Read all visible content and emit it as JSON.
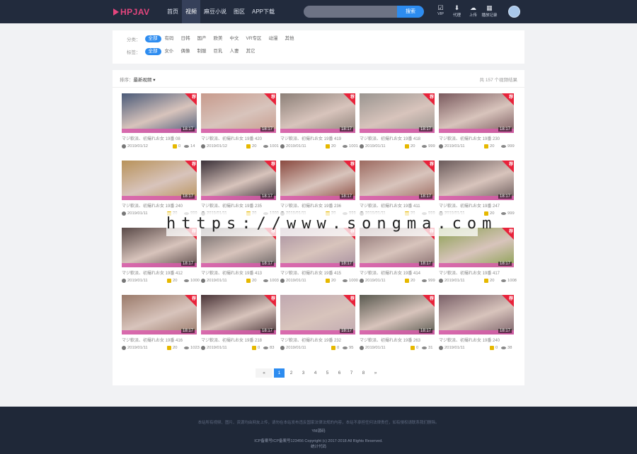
{
  "header": {
    "logo": "HPJAV",
    "nav": [
      "首页",
      "视频",
      "麻豆小说",
      "图区",
      "APP下载"
    ],
    "active_nav": 1,
    "search_placeholder": "",
    "search_button": "搜索",
    "icons": [
      {
        "icon": "vip-icon",
        "label": "VIP"
      },
      {
        "icon": "download-icon",
        "label": "代理"
      },
      {
        "icon": "upload-icon",
        "label": "上传"
      },
      {
        "icon": "history-icon",
        "label": "播放记录"
      }
    ]
  },
  "filters": {
    "row1": {
      "label": "分类：",
      "options": [
        "全部",
        "有码",
        "日韩",
        "国产",
        "欧美",
        "中文",
        "VR专区",
        "动漫",
        "其他"
      ],
      "selected": 0
    },
    "row2": {
      "label": "标签：",
      "options": [
        "全部",
        "女仆",
        "偶像",
        "制服",
        "巨乳",
        "人妻",
        "其它"
      ],
      "selected": 0
    }
  },
  "sortbar": {
    "label": "排序：",
    "value": "最新视频 ▾",
    "total": "共 157 个视频结果"
  },
  "cards": [
    {
      "title": "マジ軟派、初撮れお女 19番 08",
      "date": "2019/01/12",
      "coins": "0",
      "views": "14",
      "ribbon": "荐",
      "duration": "18:17",
      "color": "#4a5a78"
    },
    {
      "title": "マジ軟派、初撮れお女 19番 420",
      "date": "2019/01/12",
      "coins": "20",
      "views": "1001",
      "ribbon": "荐",
      "duration": "18:17",
      "color": "#c79a8c"
    },
    {
      "title": "マジ軟派、初撮れお女 19番 419",
      "date": "2019/01/11",
      "coins": "20",
      "views": "1001",
      "ribbon": "荐",
      "duration": "18:17",
      "color": "#8c8078"
    },
    {
      "title": "マジ軟派、初撮れお女 19番 418",
      "date": "2019/01/11",
      "coins": "20",
      "views": "999",
      "ribbon": "荐",
      "duration": "18:17",
      "color": "#9a9590"
    },
    {
      "title": "マジ軟派、初撮れお女 19番 230",
      "date": "2019/01/11",
      "coins": "20",
      "views": "999",
      "ribbon": "荐",
      "duration": "18:17",
      "color": "#7a5a5e"
    },
    {
      "title": "マジ軟派、初撮れお女 19番 240",
      "date": "2019/01/11",
      "coins": "20",
      "views": "999",
      "ribbon": "荐",
      "duration": "18:17",
      "color": "#b8925a"
    },
    {
      "title": "マジ軟派、初撮れお女 19番 235",
      "date": "2019/01/11",
      "coins": "20",
      "views": "1000",
      "ribbon": "荐",
      "duration": "18:17",
      "color": "#3a3038"
    },
    {
      "title": "マジ軟派、初撮れお女 19番 236",
      "date": "2019/01/11",
      "coins": "20",
      "views": "999",
      "ribbon": "荐",
      "duration": "18:17",
      "color": "#8a4a40"
    },
    {
      "title": "マジ軟派、初撮れお女 19番 411",
      "date": "2019/01/11",
      "coins": "20",
      "views": "999",
      "ribbon": "荐",
      "duration": "18:17",
      "color": "#9c6a60"
    },
    {
      "title": "マジ軟派、初撮れお女 19番 247",
      "date": "2019/01/11",
      "coins": "20",
      "views": "999",
      "ribbon": "荐",
      "duration": "18:17",
      "color": "#6a5a5a"
    },
    {
      "title": "マジ軟派、初撮れお女 19番 412",
      "date": "2019/01/11",
      "coins": "20",
      "views": "1000",
      "ribbon": "荐",
      "duration": "18:17",
      "color": "#5a4a48"
    },
    {
      "title": "マジ軟派、初撮れお女 19番 413",
      "date": "2019/01/11",
      "coins": "20",
      "views": "1003",
      "ribbon": "荐",
      "duration": "18:17",
      "color": "#6a6464"
    },
    {
      "title": "マジ軟派、初撮れお女 19番 415",
      "date": "2019/01/11",
      "coins": "20",
      "views": "1000",
      "ribbon": "荐",
      "duration": "18:17",
      "color": "#a890a0"
    },
    {
      "title": "マジ軟派、初撮れお女 19番 414",
      "date": "2019/01/11",
      "coins": "20",
      "views": "999",
      "ribbon": "荐",
      "duration": "18:17",
      "color": "#8a7070"
    },
    {
      "title": "マジ軟派、初撮れお女 19番 417",
      "date": "2019/01/11",
      "coins": "20",
      "views": "1008",
      "ribbon": "荐",
      "duration": "18:17",
      "color": "#8aa050"
    },
    {
      "title": "マジ軟派、初撮れお女 19番 416",
      "date": "2019/01/11",
      "coins": "20",
      "views": "1023",
      "ribbon": "荐",
      "duration": "18:17",
      "color": "#9a7a6a"
    },
    {
      "title": "マジ軟派、初撮れお女 19番 218",
      "date": "2019/01/11",
      "coins": "0",
      "views": "83",
      "ribbon": "荐",
      "duration": "18:17",
      "color": "#4a3438"
    },
    {
      "title": "マジ軟派、初撮れお女 19番 232",
      "date": "2019/01/11",
      "coins": "0",
      "views": "95",
      "ribbon": "荐",
      "duration": "18:17",
      "color": "#c0a8b0"
    },
    {
      "title": "マジ軟派、初撮れお女 19番 263",
      "date": "2019/01/11",
      "coins": "0",
      "views": "31",
      "ribbon": "荐",
      "duration": "18:17",
      "color": "#5a5a50"
    },
    {
      "title": "マジ軟派、初撮れお女 19番 240",
      "date": "2019/01/11",
      "coins": "0",
      "views": "38",
      "ribbon": "荐",
      "duration": "18:17",
      "color": "#7a6068"
    }
  ],
  "pagination": {
    "prev": "«",
    "pages": [
      "1",
      "2",
      "3",
      "4",
      "5",
      "6",
      "7",
      "8"
    ],
    "current": 0,
    "next": "»"
  },
  "watermark": "https://www.songma.com",
  "footer": {
    "line1": "本站所有视频、图片、资源均由网友上传，请勿在本站发布违反国家法律法规的内容，本站不承担任何法律责任，如有侵权请联系我们删除。",
    "line2": "YM源码",
    "line3": "ICP备案号ICP备案号123456  Copyright (c) 2017-2018 All Rights Reserved.",
    "line4": "统计代码"
  }
}
